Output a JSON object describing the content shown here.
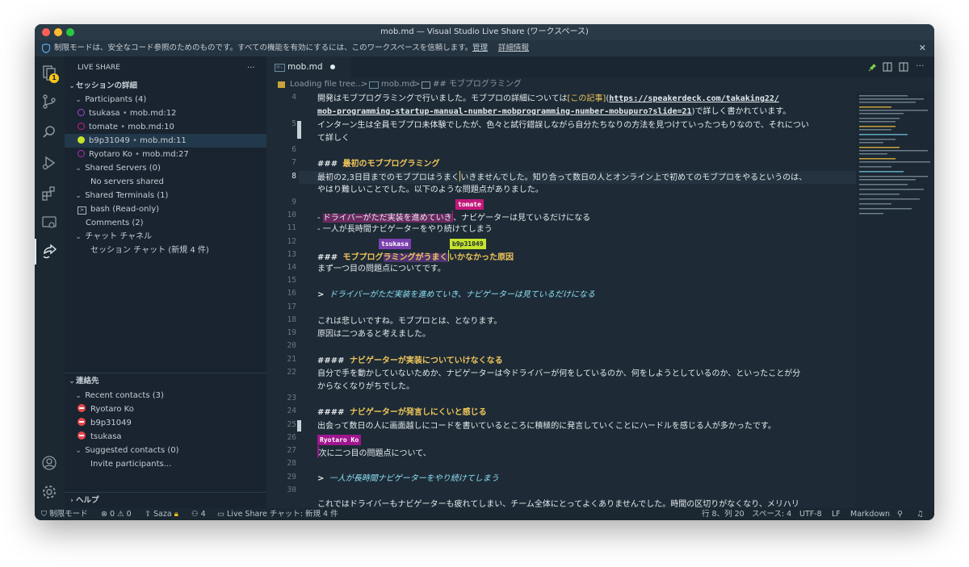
{
  "window": {
    "title": "mob.md — Visual Studio Live Share (ワークスペース)"
  },
  "restricted": {
    "message": "制限モードは、安全なコード参照のためのものです。すべての機能を有効にするには、このワークスペースを信頼します。",
    "manage": "管理",
    "details": "詳細情報"
  },
  "activity": {
    "badge": "1"
  },
  "sidebar": {
    "title": "LIVE SHARE",
    "more": "···",
    "session_details": "セッションの詳細",
    "participants_header": "Participants (4)",
    "participants": [
      {
        "name": "tsukasa",
        "loc": "mob.md:12"
      },
      {
        "name": "tomate",
        "loc": "mob.md:10"
      },
      {
        "name": "b9p31049",
        "loc": "mob.md:11"
      },
      {
        "name": "Ryotaro Ko",
        "loc": "mob.md:27"
      }
    ],
    "sep": "•",
    "shared_servers": "Shared Servers (0)",
    "no_servers": "No servers shared",
    "shared_terminals": "Shared Terminals (1)",
    "terminal": "bash (Read-only)",
    "comments": "Comments (2)",
    "chat_channel": "チャット チャネル",
    "session_chat": "セッション チャット (新規 4 件)",
    "contacts_header": "連絡先",
    "recent_header": "Recent contacts (3)",
    "recent": [
      "Ryotaro Ko",
      "b9p31049",
      "tsukasa"
    ],
    "suggested_header": "Suggested contacts (0)",
    "invite": "Invite participants...",
    "help": "ヘルプ"
  },
  "tab": {
    "label": "mob.md"
  },
  "breadcrumb": {
    "loading": "Loading file tree...",
    "sep": ">",
    "file": "mob.md",
    "section": "## モブプログラミング"
  },
  "editor": {
    "l4a": "開発はモブプログラミングで行いました。モブプロの詳細については",
    "l4_link": "[この記事]",
    "l4_url1": "https://speakerdeck.com/takaking22/",
    "l4_url2": "mob-programming-startup-manual-number-mobprogramming-number-mobupuro?slide=21",
    "l4_tail": "で詳しく書かれています。",
    "l5a": "インターン生は全員モブプロ未体験でしたが、色々と試行錯誤しながら自分たちなりの方法を見つけていったつもりなので、それについ",
    "l5b": "て詳しく",
    "h3": "###",
    "h4": "####",
    "l7": "最初のモブプログラミング",
    "l8a": "最初の2,3日目までのモブプロはうまく",
    "l8b": "いきませんでした。知り合って数日の人とオンライン上で初めてのモブプロをやるというのは、",
    "l8c": "やはり難しいことでした。以下のような問題点がありました。",
    "dash": "-",
    "l10a": "ドライバーがただ実装を進めていき",
    "l10b": "、ナビゲーターは見ているだけになる",
    "l11": "一人が長時間ナビゲーターをやり続けてしまう",
    "l13a": "モブプログ",
    "l13b": "ラミングがうまく",
    "l13c": "いかなかった原因",
    "l14": "まず一つ目の問題点についてです。",
    "gt": ">",
    "l16": "ドライバーがただ実装を進めていき、ナビゲーターは見ているだけになる",
    "l18": "これは悲しいですね。モブプロとは、となります。",
    "l19": "原因は二つあると考えました。",
    "l21": "ナビゲーターが実装についていけなくなる",
    "l22a": "自分で手を動かしていないためか、ナビゲーターは今ドライバーが何をしているのか、何をしようとしているのか、といったことが分",
    "l22b": "からなくなりがちでした。",
    "l24": "ナビゲーターが発言しにくいと感じる",
    "l25": "出会って数日の人に画面越しにコードを書いているところに積極的に発言していくことにハードルを感じる人が多かったです。",
    "l27": "次に二つ目の問題点について、",
    "l29": "一人が長時間ナビゲーターをやり続けてしまう",
    "l31": "これではドライバーもナビゲーターも疲れてしまい、チーム全体にとってよくありませんでした。時間の区切りがなくなり、メリハリ"
  },
  "line_numbers": [
    "4",
    "5",
    "6",
    "7",
    "8",
    "9",
    "10",
    "11",
    "12",
    "13",
    "14",
    "15",
    "16",
    "17",
    "18",
    "19",
    "20",
    "21",
    "22",
    "23",
    "24",
    "25",
    "26",
    "27",
    "28",
    "29",
    "30"
  ],
  "cursors": {
    "tomate": "tomate",
    "tsukasa": "tsukasa",
    "b9p": "b9p31049",
    "ryotaro": "Ryotaro Ko"
  },
  "colors": {
    "tomate": "#c2187a",
    "tsukasa": "#7b3fb0",
    "b9p": "#c6e42c",
    "ryotaro": "#a0168e",
    "heading": "#f0c65a",
    "quote": "#8ce0f2"
  },
  "statusbar": {
    "mode": "制限モード",
    "errors": "0",
    "warnings": "0",
    "user": "Saza",
    "count": "4",
    "chat": "Live Share チャット: 新規 4 件",
    "position": "行 8、列 20",
    "spaces": "スペース: 4",
    "encoding": "UTF-8",
    "eol": "LF",
    "language": "Markdown"
  }
}
